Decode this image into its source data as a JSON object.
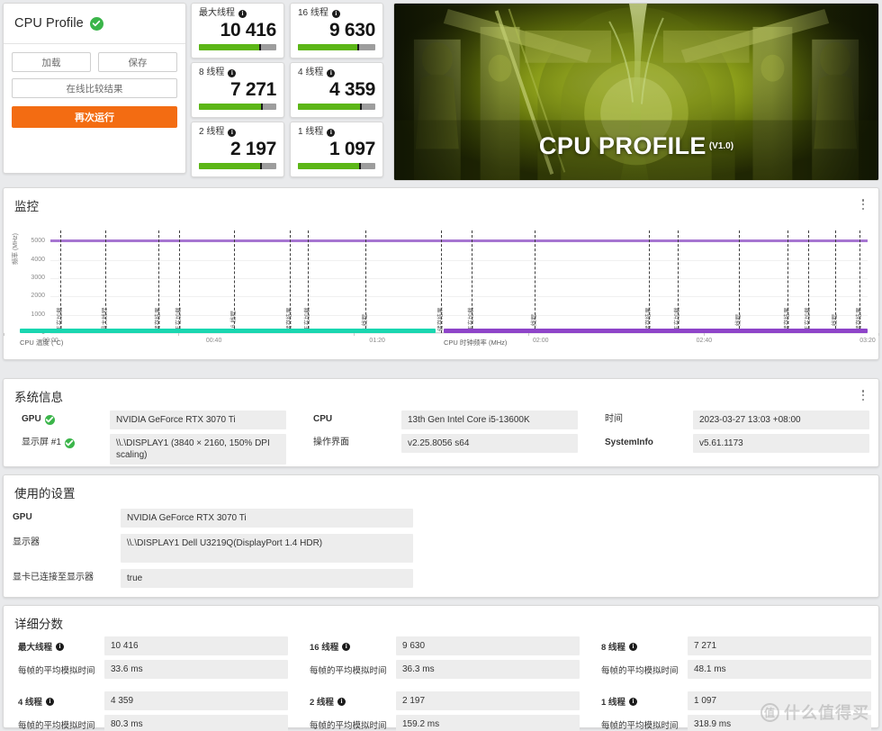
{
  "profile": {
    "title": "CPU Profile",
    "verified_icon": "check-badge-icon",
    "buttons": {
      "load": "加载",
      "save": "保存",
      "compare_online": "在线比较结果",
      "run_again": "再次运行"
    }
  },
  "score_cards": [
    {
      "label": "最大线程",
      "value": "10 416",
      "fill_pct": 78
    },
    {
      "label": "16 线程",
      "value": "9 630",
      "fill_pct": 77
    },
    {
      "label": "8 线程",
      "value": "7 271",
      "fill_pct": 80
    },
    {
      "label": "4 线程",
      "value": "4 359",
      "fill_pct": 80
    },
    {
      "label": "2 线程",
      "value": "2 197",
      "fill_pct": 79
    },
    {
      "label": "1 线程",
      "value": "1 097",
      "fill_pct": 79
    }
  ],
  "hero": {
    "title": "CPU PROFILE",
    "version": "(V1.0)"
  },
  "monitor": {
    "title": "监控",
    "menu_icon": "kebab-menu-icon"
  },
  "chart_data": {
    "type": "line",
    "title": "监控",
    "xlabel": "",
    "ylabel": "频率 (MHz)",
    "ylim": [
      0,
      5600
    ],
    "yticks": [
      0,
      1000,
      2000,
      3000,
      4000,
      5000
    ],
    "xlim_seconds": [
      0,
      200
    ],
    "xticks": [
      "00:00",
      "00:40",
      "01:20",
      "02:00",
      "02:40",
      "03:20"
    ],
    "xtick_seconds": [
      0,
      40,
      80,
      120,
      160,
      200
    ],
    "grid": true,
    "legend_position": "bottom",
    "series": [
      {
        "name": "CPU 时钟频率 (MHz)",
        "color": "#a675d1",
        "constant_value": 5100,
        "note": "近乎恒定于约 5100 MHz"
      },
      {
        "name": "CPU 温度 (°C)",
        "color": "#19d6b0",
        "constant_value": null,
        "note": "图例中显示，曲线不可见"
      }
    ],
    "event_markers": [
      {
        "label": "正在加载",
        "t": 2.5
      },
      {
        "label": "最大线程",
        "t": 13.5
      },
      {
        "label": "储存结果",
        "t": 26.5
      },
      {
        "label": "正在加载",
        "t": 31.5
      },
      {
        "label": "16 线程",
        "t": 45.0
      },
      {
        "label": "储存结果",
        "t": 58.5
      },
      {
        "label": "正在加载",
        "t": 63.0
      },
      {
        "label": "8 线程",
        "t": 77.0
      },
      {
        "label": "储存结果",
        "t": 95.5
      },
      {
        "label": "正在加载",
        "t": 103.0
      },
      {
        "label": "4 线程",
        "t": 118.5
      },
      {
        "label": "储存结果",
        "t": 146.5
      },
      {
        "label": "正在加载",
        "t": 153.5
      },
      {
        "label": "2 线程",
        "t": 168.5
      },
      {
        "label": "储存结果",
        "t": 180.5
      },
      {
        "label": "正在加载",
        "t": 185.5
      },
      {
        "label": "1 线程",
        "t": 192.0
      },
      {
        "label": "储存结果",
        "t": 198.0
      }
    ]
  },
  "legend": {
    "temp": {
      "label": "CPU 温度 (°C)",
      "color": "#19d6b0"
    },
    "clock": {
      "label": "CPU 时钟频率 (MHz)",
      "color": "#8e44c9"
    }
  },
  "sysinfo": {
    "title": "系统信息",
    "menu_icon": "kebab-menu-icon",
    "rows_left": [
      {
        "label": "GPU",
        "verified": true,
        "value": "NVIDIA GeForce RTX 3070 Ti"
      },
      {
        "label": "显示屏 #1",
        "verified": true,
        "value": "\\\\.\\DISPLAY1 (3840 × 2160, 150% DPI scaling)"
      }
    ],
    "rows_mid": [
      {
        "label": "CPU",
        "verified": false,
        "value": "13th Gen Intel Core i5-13600K"
      },
      {
        "label": "操作界面",
        "verified": false,
        "value": "v2.25.8056 s64"
      }
    ],
    "rows_right": [
      {
        "label": "时间",
        "verified": false,
        "value": "2023-03-27 13:03 +08:00"
      },
      {
        "label": "SystemInfo",
        "verified": false,
        "value": "v5.61.1173"
      }
    ]
  },
  "settings": {
    "title": "使用的设置",
    "rows": [
      {
        "label": "GPU",
        "bold": true,
        "value": "NVIDIA GeForce RTX 3070 Ti"
      },
      {
        "label": "显示器",
        "bold": false,
        "value": "\\\\.\\DISPLAY1 Dell U3219Q(DisplayPort 1.4 HDR)"
      },
      {
        "label": "显卡已连接至显示器",
        "bold": false,
        "value": "true"
      }
    ]
  },
  "scores": {
    "title": "详细分数",
    "frametime_label": "每帧的平均模拟时间",
    "items": [
      {
        "label": "最大线程",
        "score": "10 416",
        "frametime": "33.6 ms"
      },
      {
        "label": "16 线程",
        "score": "9 630",
        "frametime": "36.3 ms"
      },
      {
        "label": "8 线程",
        "score": "7 271",
        "frametime": "48.1 ms"
      },
      {
        "label": "4 线程",
        "score": "4 359",
        "frametime": "80.3 ms"
      },
      {
        "label": "2 线程",
        "score": "2 197",
        "frametime": "159.2 ms"
      },
      {
        "label": "1 线程",
        "score": "1 097",
        "frametime": "318.9 ms"
      }
    ]
  },
  "watermark": {
    "mark": "值",
    "text": "什么值得买"
  }
}
